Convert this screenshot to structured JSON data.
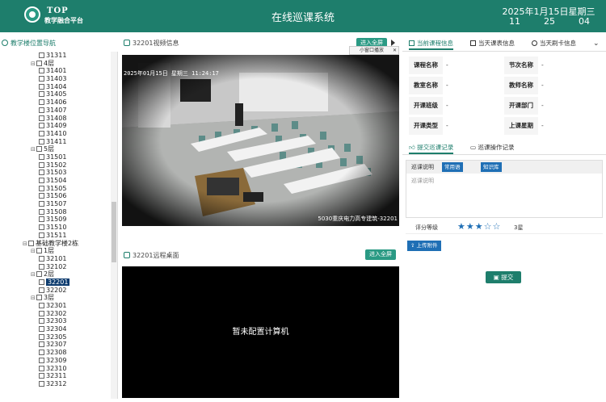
{
  "header": {
    "brand_en": "TOP",
    "brand_cn": "教学融合平台",
    "title": "在线巡课系统",
    "date": "2025年1月15日星期三",
    "hour": "11",
    "minute": "25",
    "second": "04",
    "color": "#1e7e6c"
  },
  "sidebar": {
    "title": "教学楼位置导航",
    "rows": [
      {
        "indent": 3,
        "type": "room",
        "label": "31311"
      },
      {
        "indent": 2,
        "type": "floor",
        "label": "4层"
      },
      {
        "indent": 3,
        "type": "room",
        "label": "31401"
      },
      {
        "indent": 3,
        "type": "room",
        "label": "31403"
      },
      {
        "indent": 3,
        "type": "room",
        "label": "31404"
      },
      {
        "indent": 3,
        "type": "room",
        "label": "31405"
      },
      {
        "indent": 3,
        "type": "room",
        "label": "31406"
      },
      {
        "indent": 3,
        "type": "room",
        "label": "31407"
      },
      {
        "indent": 3,
        "type": "room",
        "label": "31408"
      },
      {
        "indent": 3,
        "type": "room",
        "label": "31409"
      },
      {
        "indent": 3,
        "type": "room",
        "label": "31410"
      },
      {
        "indent": 3,
        "type": "room",
        "label": "31411"
      },
      {
        "indent": 2,
        "type": "floor",
        "label": "5层"
      },
      {
        "indent": 3,
        "type": "room",
        "label": "31501"
      },
      {
        "indent": 3,
        "type": "room",
        "label": "31502"
      },
      {
        "indent": 3,
        "type": "room",
        "label": "31503"
      },
      {
        "indent": 3,
        "type": "room",
        "label": "31504"
      },
      {
        "indent": 3,
        "type": "room",
        "label": "31505"
      },
      {
        "indent": 3,
        "type": "room",
        "label": "31506"
      },
      {
        "indent": 3,
        "type": "room",
        "label": "31507"
      },
      {
        "indent": 3,
        "type": "room",
        "label": "31508"
      },
      {
        "indent": 3,
        "type": "room",
        "label": "31509"
      },
      {
        "indent": 3,
        "type": "room",
        "label": "31510"
      },
      {
        "indent": 3,
        "type": "room",
        "label": "31511"
      },
      {
        "indent": 1,
        "type": "building",
        "label": "基础教学楼2栋"
      },
      {
        "indent": 2,
        "type": "floor",
        "label": "1层"
      },
      {
        "indent": 3,
        "type": "room",
        "label": "32101"
      },
      {
        "indent": 3,
        "type": "room",
        "label": "32102"
      },
      {
        "indent": 2,
        "type": "floor",
        "label": "2层"
      },
      {
        "indent": 3,
        "type": "room",
        "label": "32201",
        "selected": true
      },
      {
        "indent": 3,
        "type": "room",
        "label": "32202"
      },
      {
        "indent": 2,
        "type": "floor",
        "label": "3层"
      },
      {
        "indent": 3,
        "type": "room",
        "label": "32301"
      },
      {
        "indent": 3,
        "type": "room",
        "label": "32302"
      },
      {
        "indent": 3,
        "type": "room",
        "label": "32303"
      },
      {
        "indent": 3,
        "type": "room",
        "label": "32304"
      },
      {
        "indent": 3,
        "type": "room",
        "label": "32305"
      },
      {
        "indent": 3,
        "type": "room",
        "label": "32307"
      },
      {
        "indent": 3,
        "type": "room",
        "label": "32308"
      },
      {
        "indent": 3,
        "type": "room",
        "label": "32309"
      },
      {
        "indent": 3,
        "type": "room",
        "label": "32310"
      },
      {
        "indent": 3,
        "type": "room",
        "label": "32311"
      },
      {
        "indent": 3,
        "type": "room",
        "label": "32312"
      }
    ]
  },
  "video_panel": {
    "title": "32201视频信息",
    "fullscreen_label": "进入全屏",
    "mini_label": "小窗口播放",
    "timestamp": "2025年01月15日 星期三 11:24:17",
    "location": "5030重庆电力高专建筑-32201"
  },
  "remote_panel": {
    "title": "32201远程桌面",
    "fullscreen_label": "进入全屏",
    "message": "暂未配置计算机"
  },
  "right": {
    "tabs": [
      "当前课程信息",
      "当天课表信息",
      "当天刷卡信息"
    ],
    "info": [
      {
        "label": "课程名称",
        "value": "-"
      },
      {
        "label": "节次名称",
        "value": "-"
      },
      {
        "label": "教室名称",
        "value": "-"
      },
      {
        "label": "教师名称",
        "value": "-"
      },
      {
        "label": "开课班级",
        "value": "-"
      },
      {
        "label": "开课部门",
        "value": "-"
      },
      {
        "label": "开课类型",
        "value": "-"
      },
      {
        "label": "上课星期",
        "value": "-"
      }
    ],
    "sub_tabs": [
      "提交巡课记录",
      "巡课操作记录"
    ],
    "remark_label": "巡课说明",
    "common_btn": "常用语",
    "knowledge_btn": "知识库",
    "remark_placeholder": "巡课说明",
    "rating_label": "评分等级",
    "rating_value": 3,
    "rating_max": 5,
    "rating_text": "3星",
    "upload_label": "上传附件",
    "submit_label": "提交"
  }
}
